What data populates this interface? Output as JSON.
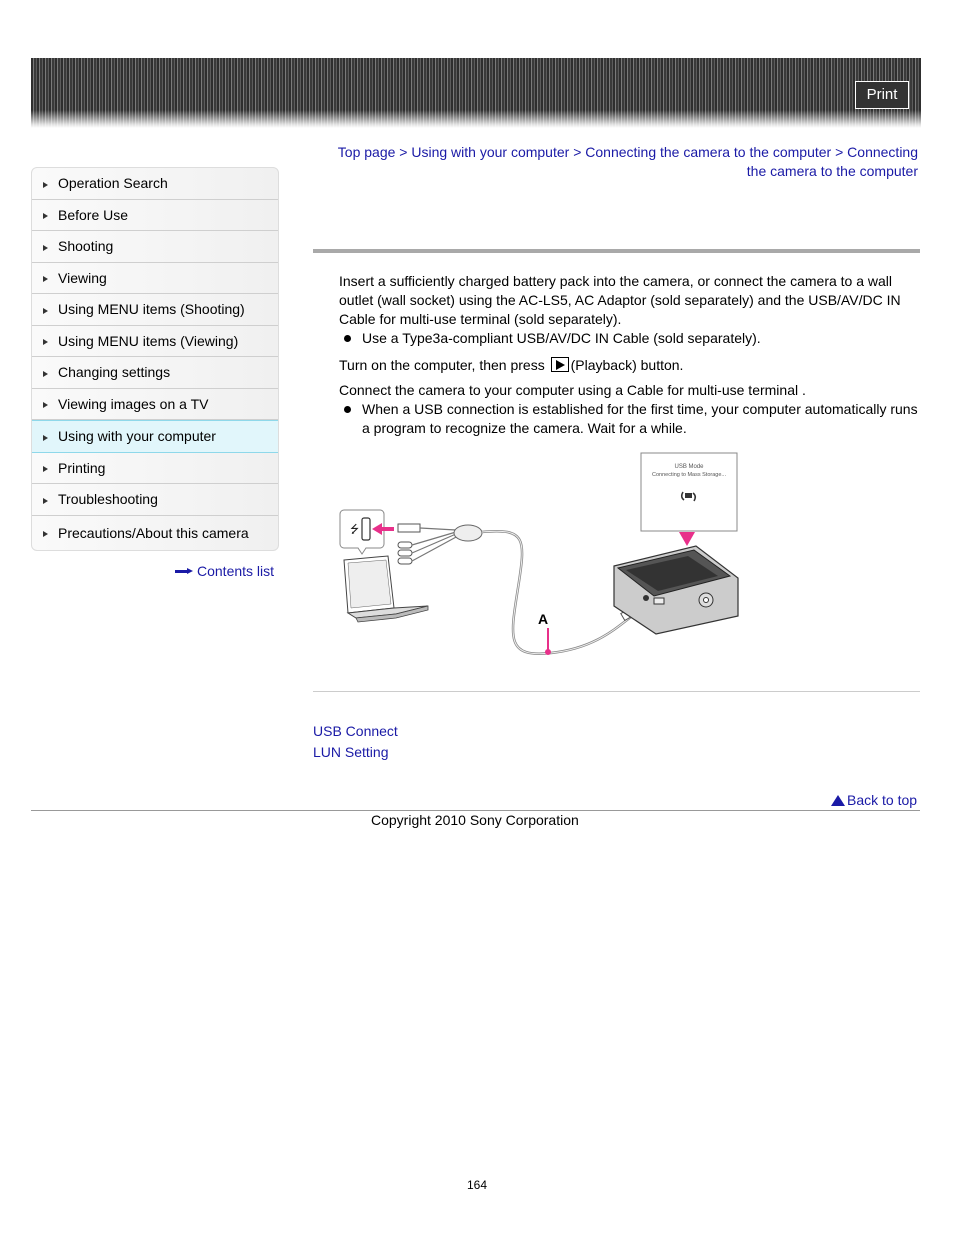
{
  "header": {
    "print_label": "Print"
  },
  "sidebar": {
    "items": [
      {
        "label": "Operation Search",
        "active": false
      },
      {
        "label": "Before Use",
        "active": false
      },
      {
        "label": "Shooting",
        "active": false
      },
      {
        "label": "Viewing",
        "active": false
      },
      {
        "label": "Using MENU items (Shooting)",
        "active": false
      },
      {
        "label": "Using MENU items (Viewing)",
        "active": false
      },
      {
        "label": "Changing settings",
        "active": false
      },
      {
        "label": "Viewing images on a TV",
        "active": false
      },
      {
        "label": "Using with your computer",
        "active": true
      },
      {
        "label": "Printing",
        "active": false
      },
      {
        "label": "Troubleshooting",
        "active": false
      },
      {
        "label": "Precautions/About this camera",
        "active": false
      }
    ],
    "contents_list": "Contents list"
  },
  "breadcrumb": {
    "items": [
      "Top page",
      "Using with your computer",
      "Connecting the camera to the computer",
      "Connecting the camera to the computer"
    ],
    "separator": ">"
  },
  "content": {
    "step1": "Insert a sufficiently charged battery pack into the camera, or connect the camera to a wall outlet (wall socket) using the AC-LS5, AC Adaptor (sold separately) and the USB/AV/DC IN Cable for multi-use terminal (sold separately).",
    "step1_bullet": "Use a Type3a-compliant USB/AV/DC IN Cable (sold separately).",
    "step2_before": "Turn on the computer, then press",
    "step2_icon": "playback-icon",
    "step2_after": "(Playback) button.",
    "step3": "Connect the camera to your computer using a Cable for multi-use terminal      .",
    "step3_bullet": "When a USB connection is established for the first time, your computer automatically runs a program to recognize the camera. Wait for a while."
  },
  "diagram": {
    "screen_line1": "USB Mode",
    "screen_line2": "Connecting to Mass Storage...",
    "callout_label": "A",
    "accent_color": "#e8308a"
  },
  "related": {
    "links": [
      "USB Connect",
      "LUN Setting"
    ]
  },
  "footer": {
    "back_to_top": "Back to top",
    "copyright": "Copyright 2010 Sony Corporation",
    "page_number": "164"
  }
}
